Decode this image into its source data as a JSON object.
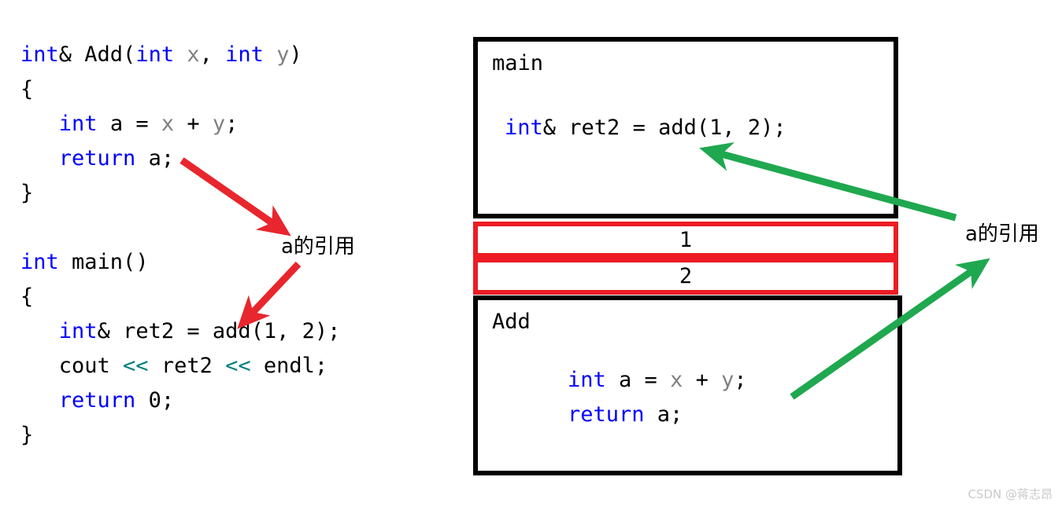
{
  "left_code": {
    "name": "function-and-main-source",
    "lines": [
      {
        "id": "l1",
        "segments": [
          {
            "t": "int",
            "c": "kw"
          },
          {
            "t": "& Add(",
            "c": "pl"
          },
          {
            "t": "int",
            "c": "kw"
          },
          {
            "t": " ",
            "c": "pl"
          },
          {
            "t": "x",
            "c": "var"
          },
          {
            "t": ", ",
            "c": "pl"
          },
          {
            "t": "int",
            "c": "kw"
          },
          {
            "t": " ",
            "c": "pl"
          },
          {
            "t": "y",
            "c": "var"
          },
          {
            "t": ")",
            "c": "pl"
          }
        ]
      },
      {
        "id": "l2",
        "segments": [
          {
            "t": "{",
            "c": "pl"
          }
        ]
      },
      {
        "id": "l3",
        "segments": [
          {
            "t": "   ",
            "c": "pl"
          },
          {
            "t": "int",
            "c": "kw"
          },
          {
            "t": " a = ",
            "c": "pl"
          },
          {
            "t": "x",
            "c": "var"
          },
          {
            "t": " + ",
            "c": "pl"
          },
          {
            "t": "y",
            "c": "var"
          },
          {
            "t": ";",
            "c": "pl"
          }
        ]
      },
      {
        "id": "l4",
        "segments": [
          {
            "t": "   ",
            "c": "pl"
          },
          {
            "t": "return",
            "c": "kw"
          },
          {
            "t": " a;",
            "c": "pl"
          }
        ]
      },
      {
        "id": "l5",
        "segments": [
          {
            "t": "}",
            "c": "pl"
          }
        ]
      },
      {
        "id": "l6",
        "segments": [
          {
            "t": " ",
            "c": "pl"
          }
        ]
      },
      {
        "id": "l7",
        "segments": [
          {
            "t": "int",
            "c": "kw"
          },
          {
            "t": " main()",
            "c": "pl"
          }
        ]
      },
      {
        "id": "l8",
        "segments": [
          {
            "t": "{",
            "c": "pl"
          }
        ]
      },
      {
        "id": "l9",
        "segments": [
          {
            "t": "   ",
            "c": "pl"
          },
          {
            "t": "int",
            "c": "kw"
          },
          {
            "t": "& ret2 = add(1, 2);",
            "c": "pl"
          }
        ]
      },
      {
        "id": "l10",
        "segments": [
          {
            "t": "   cout ",
            "c": "pl"
          },
          {
            "t": "<<",
            "c": "op"
          },
          {
            "t": " ret2 ",
            "c": "pl"
          },
          {
            "t": "<<",
            "c": "op"
          },
          {
            "t": " endl;",
            "c": "pl"
          }
        ]
      },
      {
        "id": "l11",
        "segments": [
          {
            "t": "   ",
            "c": "pl"
          },
          {
            "t": "return",
            "c": "kw"
          },
          {
            "t": " 0;",
            "c": "pl"
          }
        ]
      },
      {
        "id": "l12",
        "segments": [
          {
            "t": "}",
            "c": "pl"
          }
        ]
      }
    ]
  },
  "annotations": {
    "left_label": "a的引用",
    "right_label": "a的引用"
  },
  "diagram": {
    "main_frame": {
      "title": "main",
      "code_lines": [
        {
          "id": "m1",
          "segments": [
            {
              "t": "int",
              "c": "kw"
            },
            {
              "t": "& ret2 = add(1, 2);",
              "c": "pl"
            }
          ]
        }
      ]
    },
    "stack_slots": [
      {
        "value": "1"
      },
      {
        "value": "2"
      }
    ],
    "add_frame": {
      "title": "Add",
      "code_lines": [
        {
          "id": "a1",
          "segments": [
            {
              "t": "int",
              "c": "kw"
            },
            {
              "t": " a = ",
              "c": "pl"
            },
            {
              "t": "x",
              "c": "var"
            },
            {
              "t": " + ",
              "c": "pl"
            },
            {
              "t": "y",
              "c": "var"
            },
            {
              "t": ";",
              "c": "pl"
            }
          ]
        },
        {
          "id": "a2",
          "segments": [
            {
              "t": "return",
              "c": "kw"
            },
            {
              "t": " a;",
              "c": "pl"
            }
          ]
        }
      ]
    }
  },
  "colors": {
    "keyword": "#0000ff",
    "variable": "#808080",
    "operator": "#008080",
    "red_arrow": "#e8262d",
    "green_arrow": "#1fa84f",
    "red_box": "#ed1c24",
    "black_box": "#000000"
  },
  "watermark": "CSDN @蒋志昂"
}
